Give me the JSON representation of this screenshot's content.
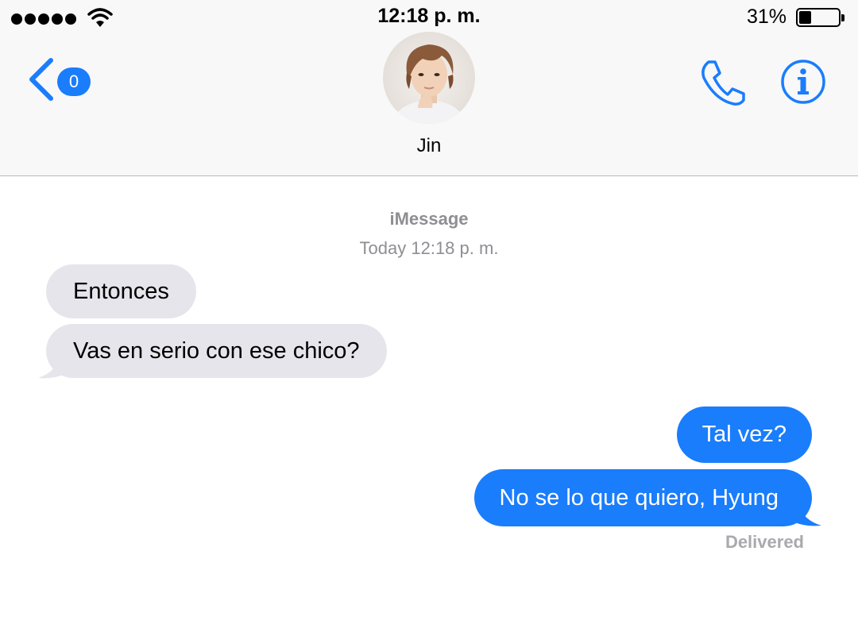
{
  "status_bar": {
    "time": "12:18 p. m.",
    "battery_percent": "31%",
    "battery_level": 0.31,
    "signal_bars": 5,
    "icons": [
      "signal-dots-icon",
      "wifi-icon",
      "battery-icon"
    ]
  },
  "header": {
    "back_badge": "0",
    "contact_name": "Jin",
    "icons": [
      "back-chevron-icon",
      "phone-icon",
      "info-icon"
    ]
  },
  "conversation": {
    "service": "iMessage",
    "timestamp": "Today 12:18 p. m.",
    "messages": [
      {
        "direction": "incoming",
        "text": "Entonces"
      },
      {
        "direction": "incoming",
        "text": "Vas en serio con ese chico?"
      },
      {
        "direction": "outgoing",
        "text": "Tal vez?"
      },
      {
        "direction": "outgoing",
        "text": "No se lo que quiero, Hyung"
      }
    ],
    "delivery_status": "Delivered"
  },
  "colors": {
    "accent": "#1a7dfc",
    "incoming_bubble": "#e6e5eb",
    "header_bg": "#f8f8f9",
    "secondary_text": "#8e8e93"
  }
}
